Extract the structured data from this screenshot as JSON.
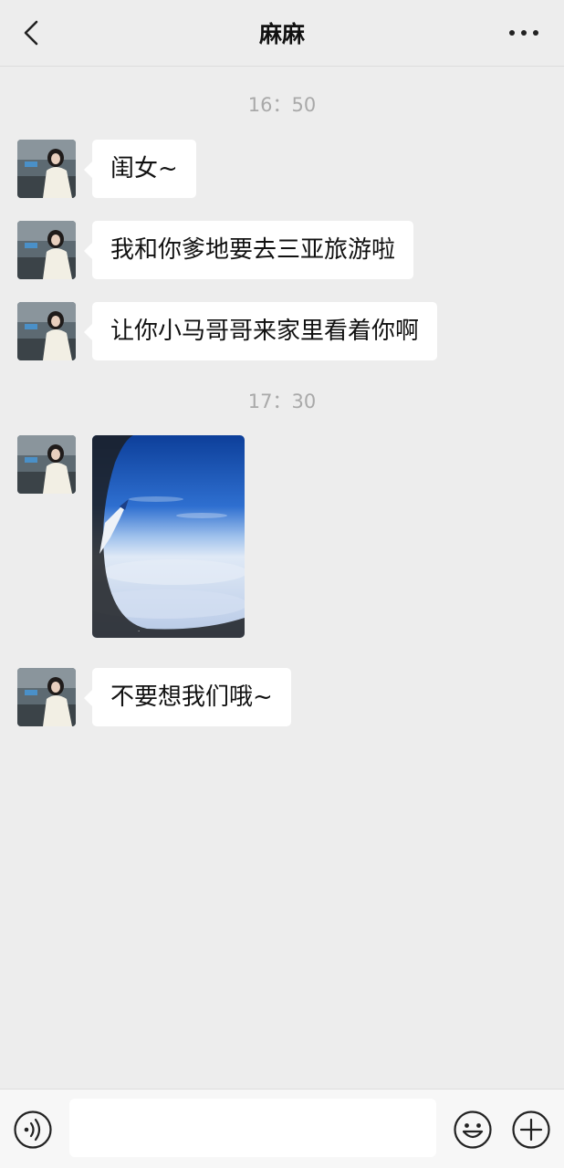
{
  "header": {
    "title": "麻麻",
    "back_icon": "chevron-left-icon",
    "more_icon": "more-dots-icon"
  },
  "messages": {
    "time_1": "16：50",
    "msg_1": "闺女~",
    "msg_2": "我和你爹地要去三亚旅游啦",
    "msg_3": "让你小马哥哥来家里看着你啊",
    "time_2": "17：30",
    "photo_icon": "airplane-window-photo",
    "msg_4": "不要想我们哦~"
  },
  "input_bar": {
    "voice_icon": "voice-icon",
    "input_value": "",
    "emoji_icon": "emoji-icon",
    "plus_icon": "plus-icon"
  },
  "colors": {
    "background": "#ededed",
    "bubble": "#ffffff",
    "timestamp": "#a9a9a9"
  }
}
